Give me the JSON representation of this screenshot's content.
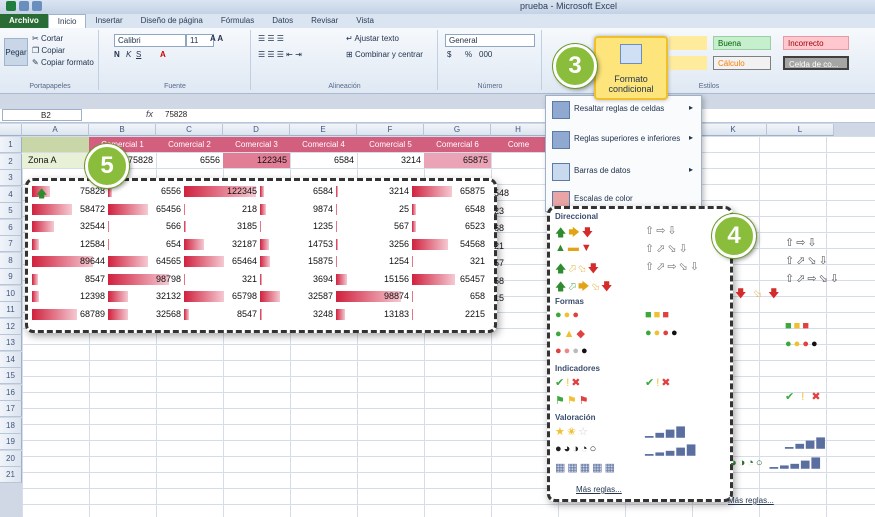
{
  "window": {
    "title": "prueba - Microsoft Excel"
  },
  "tabs": [
    "Archivo",
    "Inicio",
    "Insertar",
    "Diseño de página",
    "Fórmulas",
    "Datos",
    "Revisar",
    "Vista"
  ],
  "ribbon": {
    "clipboard": {
      "cut": "Cortar",
      "copy": "Copiar",
      "copy_format": "Copiar formato",
      "paste": "Pegar",
      "label": "Portapapeles"
    },
    "font": {
      "name": "Calibri",
      "size": "11",
      "label": "Fuente",
      "bold": "N",
      "italic": "K",
      "underline": "S"
    },
    "alignment": {
      "wrap": "Ajustar texto",
      "merge": "Combinar y centrar",
      "label": "Alineación"
    },
    "number": {
      "format": "General",
      "percent": "%",
      "thousands": "000",
      "label": "Número"
    },
    "cf_button": {
      "line1": "Formato",
      "line2": "condicional"
    },
    "styles": {
      "buena": "Buena",
      "incorrecto": "Incorrecto",
      "calculo": "Cálculo",
      "celda": "Celda de co...",
      "label": "Estilos"
    }
  },
  "formula_bar": {
    "name_box": "B2",
    "fx": "fx",
    "value": "75828"
  },
  "columns": [
    "A",
    "B",
    "C",
    "D",
    "E",
    "F",
    "G",
    "H",
    "K",
    "L"
  ],
  "rows": [
    "1",
    "2",
    "3",
    "4",
    "5",
    "6",
    "7",
    "8",
    "9",
    "10",
    "11",
    "12",
    "13",
    "14",
    "15",
    "16",
    "17",
    "18",
    "19",
    "20",
    "21"
  ],
  "sheet": {
    "headers": [
      "",
      "Comercial 1",
      "Comercial 2",
      "Comercial 3",
      "Comercial 4",
      "Comercial 5",
      "Comercial 6",
      "Come"
    ],
    "row2": [
      "Zona A",
      "75828",
      "6556",
      "122345",
      "6584",
      "3214",
      "65875"
    ]
  },
  "table": {
    "rows": [
      [
        "75828",
        "6556",
        "122345",
        "6584",
        "3214",
        "65875"
      ],
      [
        "58472",
        "65456",
        "218",
        "9874",
        "25",
        "6548"
      ],
      [
        "32544",
        "566",
        "3185",
        "1235",
        "567",
        "6523"
      ],
      [
        "12584",
        "654",
        "32187",
        "14753",
        "3256",
        "54568"
      ],
      [
        "89644",
        "64565",
        "65464",
        "15875",
        "1254",
        "321"
      ],
      [
        "8547",
        "98798",
        "321",
        "3694",
        "15156",
        "65457"
      ],
      [
        "12398",
        "32132",
        "65798",
        "32587",
        "98874",
        "658"
      ],
      [
        "68789",
        "32568",
        "8547",
        "3248",
        "13183",
        "2215"
      ]
    ],
    "bar_fractions": [
      [
        0.25,
        0.05,
        1.0,
        0.05,
        0.03,
        0.55
      ],
      [
        0.55,
        0.55,
        0.02,
        0.08,
        0.01,
        0.05
      ],
      [
        0.3,
        0.01,
        0.03,
        0.01,
        0.01,
        0.05
      ],
      [
        0.1,
        0.01,
        0.28,
        0.13,
        0.03,
        0.5
      ],
      [
        0.85,
        0.55,
        0.55,
        0.14,
        0.01,
        0.01
      ],
      [
        0.08,
        0.85,
        0.01,
        0.03,
        0.15,
        0.6
      ],
      [
        0.1,
        0.28,
        0.55,
        0.28,
        0.9,
        0.01
      ],
      [
        0.62,
        0.28,
        0.07,
        0.03,
        0.12,
        0.02
      ]
    ]
  },
  "edge_values": [
    "548",
    "23",
    "68",
    "21",
    "57",
    "58",
    "15"
  ],
  "menu": [
    {
      "label": "Resaltar reglas de celdas",
      "icon": "highlight-rules-icon"
    },
    {
      "label": "Reglas superiores e inferiores",
      "icon": "top-bottom-rules-icon"
    },
    {
      "label": "Barras de datos",
      "icon": "data-bars-icon"
    },
    {
      "label": "Escalas de color",
      "icon": "color-scales-icon"
    }
  ],
  "icon_sets": {
    "direccional": "Direccional",
    "formas": "Formas",
    "indicadores": "Indicadores",
    "valoracion": "Valoración",
    "more": "Más reglas...",
    "more_right": "Más reglas..."
  },
  "callouts": {
    "c3": "3",
    "c4": "4",
    "c5": "5"
  },
  "colors": {
    "accent_green": "#8bbd3c",
    "bar_red": "#d0213e",
    "header_pink": "#d35f7f",
    "excel_green": "#2a6c35"
  }
}
